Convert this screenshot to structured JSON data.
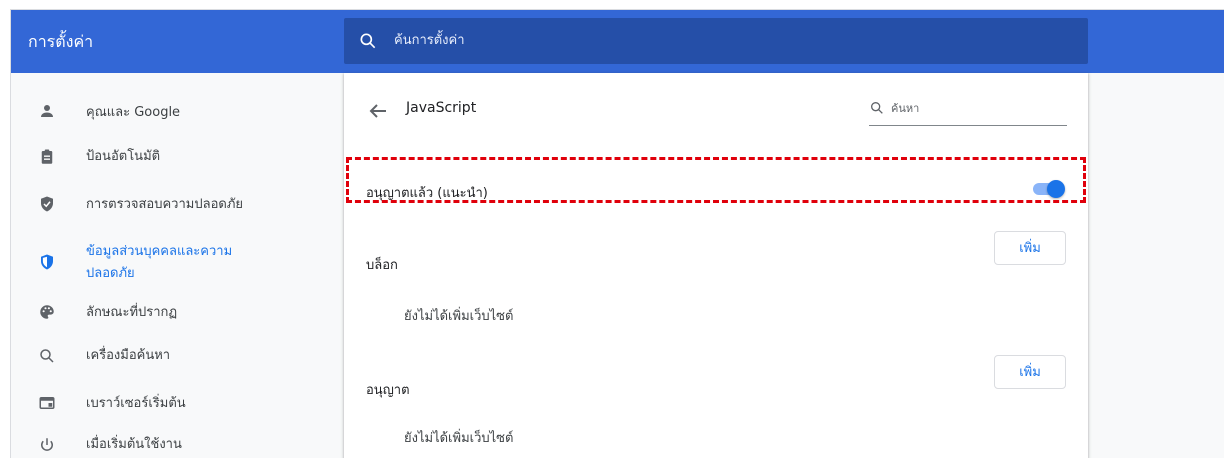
{
  "header": {
    "title": "การตั้งค่า",
    "search_placeholder": "ค้นการตั้งค่า"
  },
  "sidebar": {
    "items": [
      {
        "label": "คุณและ Google",
        "icon": "person-icon"
      },
      {
        "label": "ป้อนอัตโนมัติ",
        "icon": "clipboard-icon"
      },
      {
        "label": "การตรวจสอบความปลอดภัย",
        "icon": "shield-check-icon"
      },
      {
        "label": "ข้อมูลส่วนบุคคลและความ",
        "label_line2": "ปลอดภัย",
        "icon": "shield-icon",
        "active": true
      },
      {
        "label": "ลักษณะที่ปรากฏ",
        "icon": "palette-icon"
      },
      {
        "label": "เครื่องมือค้นหา",
        "icon": "search-icon"
      },
      {
        "label": "เบราว์เซอร์เริ่มต้น",
        "icon": "browser-icon"
      },
      {
        "label": "เมื่อเริ่มต้นใช้งาน",
        "icon": "power-icon"
      }
    ]
  },
  "content": {
    "title": "JavaScript",
    "search_placeholder": "ค้นหา",
    "allowed_toggle": {
      "label": "อนุญาตแล้ว (แนะนำ)",
      "enabled": true
    },
    "block_section": {
      "label": "บล็อก",
      "add_button": "เพิ่ม",
      "empty_text": "ยังไม่ได้เพิ่มเว็บไซต์"
    },
    "allow_section": {
      "label": "อนุญาต",
      "add_button": "เพิ่ม",
      "empty_text": "ยังไม่ได้เพิ่มเว็บไซต์"
    }
  },
  "colors": {
    "header_bg": "#3367d6",
    "search_bg": "#254fa8",
    "accent": "#1a73e8",
    "highlight_border": "#e0000b"
  }
}
